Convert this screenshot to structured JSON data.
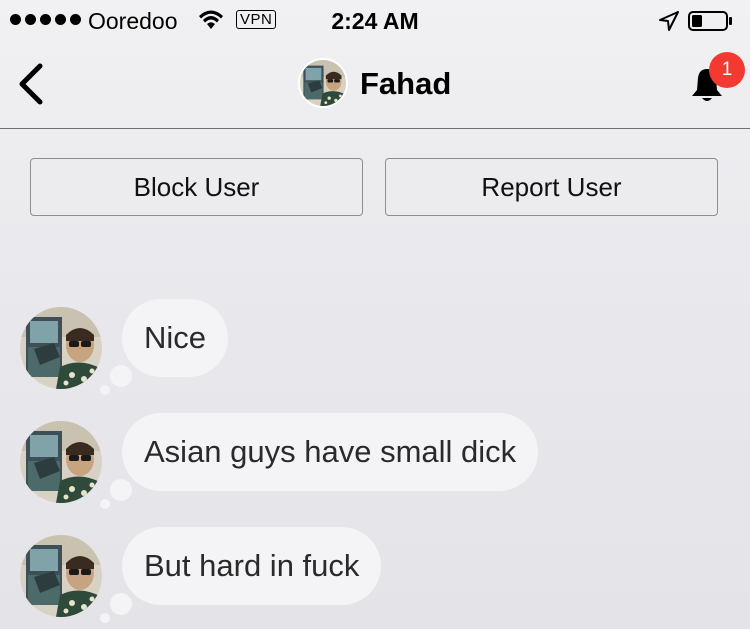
{
  "status_bar": {
    "carrier": "Ooredoo",
    "vpn": "VPN",
    "time": "2:24 AM",
    "icons": [
      "signal-icon",
      "wifi-icon",
      "location-arrow-icon",
      "battery-icon"
    ]
  },
  "nav": {
    "title": "Fahad",
    "badge_count": "1",
    "icons": [
      "back-chevron-icon",
      "bell-icon"
    ]
  },
  "actions": {
    "block": "Block User",
    "report": "Report User"
  },
  "messages": [
    {
      "text": "Nice"
    },
    {
      "text": "Asian guys have small dick"
    },
    {
      "text": "But hard in fuck"
    }
  ],
  "colors": {
    "badge": "#f23a33",
    "bubble": "#f4f4f7",
    "background": "#e9e9ed"
  }
}
